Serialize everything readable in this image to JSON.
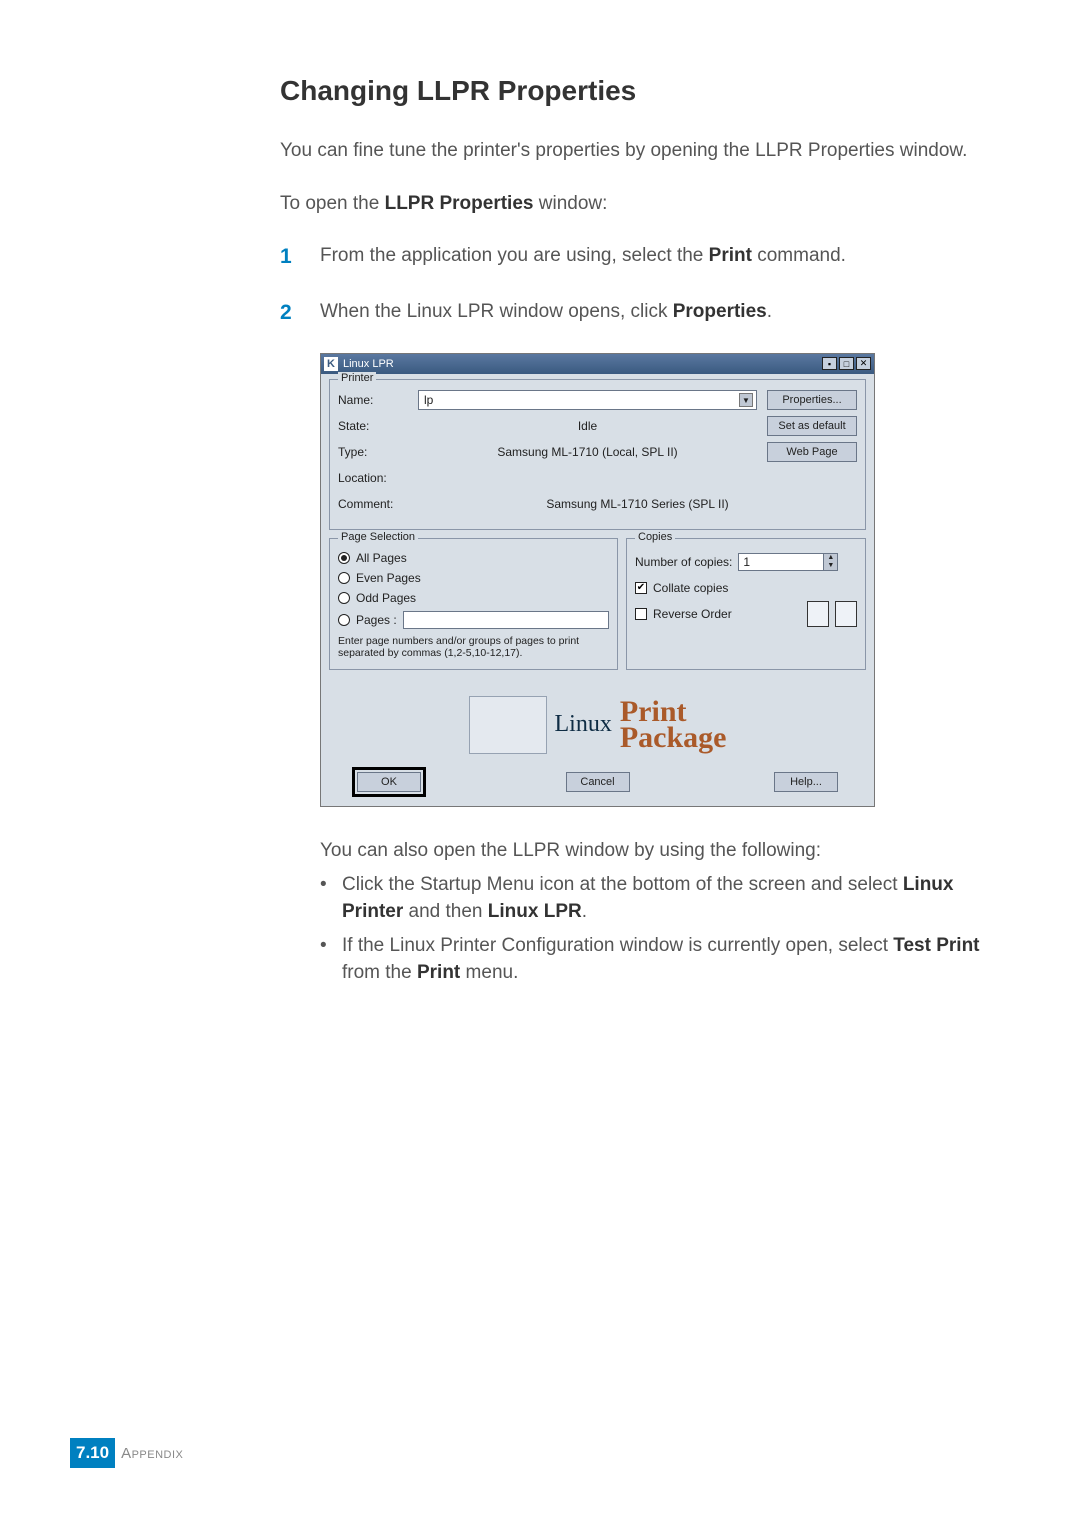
{
  "page": {
    "heading": "Changing LLPR Properties",
    "intro": "You can fine tune the printer's properties by opening the LLPR Properties window.",
    "open_lead": "To open the ",
    "open_bold": "LLPR Properties",
    "open_tail": " window:",
    "step1_lead": "From the application you are using, select the ",
    "step1_bold": "Print",
    "step1_tail": " command.",
    "step2_lead": "When the Linux LPR window opens, click ",
    "step2_bold": "Properties",
    "step2_tail": ".",
    "step1_num": "1",
    "step2_num": "2",
    "post_intro": "You can also open the LLPR window by using the following:",
    "bullet1_pre": "Click the Startup Menu icon at the bottom of the screen and select ",
    "bullet1_b1": "Linux Printer",
    "bullet1_mid": " and then ",
    "bullet1_b2": "Linux LPR",
    "bullet1_tail": ".",
    "bullet2_pre": "If the Linux Printer Configuration window is currently open, select ",
    "bullet2_b1": "Test Print",
    "bullet2_mid": " from the ",
    "bullet2_b2": "Print",
    "bullet2_tail": " menu.",
    "footer_badge": "7.10",
    "footer_label": "Appendix"
  },
  "dialog": {
    "title": "Linux LPR",
    "printer_group": "Printer",
    "name_label": "Name:",
    "name_value": "lp",
    "state_label": "State:",
    "state_value": "Idle",
    "type_label": "Type:",
    "type_value": "Samsung ML-1710 (Local, SPL II)",
    "location_label": "Location:",
    "location_value": "",
    "comment_label": "Comment:",
    "comment_value": "Samsung ML-1710 Series (SPL II)",
    "btn_properties": "Properties...",
    "btn_set_default": "Set as default",
    "btn_web_page": "Web Page",
    "page_selection_group": "Page Selection",
    "radio_all": "All Pages",
    "radio_even": "Even Pages",
    "radio_odd": "Odd Pages",
    "radio_pages": "Pages :",
    "pages_note": "Enter page numbers and/or groups of pages to print separated by commas (1,2-5,10-12,17).",
    "copies_group": "Copies",
    "copies_label": "Number of copies:",
    "copies_value": "1",
    "check_collate": "Collate copies",
    "check_reverse": "Reverse Order",
    "logo_linux": "Linux",
    "logo_line1": "Print",
    "logo_line2": "Package",
    "btn_ok": "OK",
    "btn_cancel": "Cancel",
    "btn_help": "Help..."
  }
}
